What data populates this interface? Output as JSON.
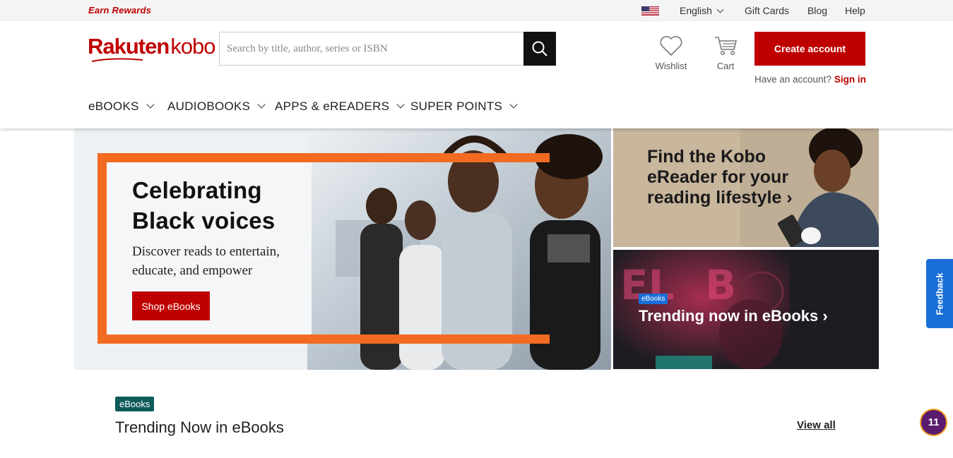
{
  "topbar": {
    "earn_rewards": "Earn Rewards",
    "language": "English",
    "gift_cards": "Gift Cards",
    "blog": "Blog",
    "help": "Help"
  },
  "header": {
    "logo_rakuten": "Rakuten",
    "logo_kobo": "kobo",
    "search_placeholder": "Search by title, author, series or ISBN",
    "wishlist": "Wishlist",
    "cart": "Cart",
    "create_account": "Create account",
    "have_account": "Have an account?",
    "sign_in": "Sign in"
  },
  "nav": {
    "items": [
      {
        "label": "eBOOKS"
      },
      {
        "label": "AUDIOBOOKS"
      },
      {
        "label": "APPS & eREADERS"
      },
      {
        "label": "SUPER POINTS"
      }
    ]
  },
  "hero": {
    "title_line1": "Celebrating",
    "title_line2": "Black voices",
    "subtitle": "Discover reads to entertain, educate, and empower",
    "button": "Shop eBooks"
  },
  "promos": {
    "ereader_title": "Find the Kobo eReader for your reading lifestyle ›",
    "trending_badge": "eBooks",
    "trending_title": "Trending now in eBooks ›"
  },
  "feedback": "Feedback",
  "trending": {
    "badge": "eBooks",
    "title": "Trending Now in eBooks",
    "view_all": "View all"
  },
  "notification_count": "11",
  "colors": {
    "brand_red": "#bf0000",
    "accent_orange": "#f26b21",
    "feedback_blue": "#1a6ed8",
    "teal_badge": "#0f5a5a"
  }
}
